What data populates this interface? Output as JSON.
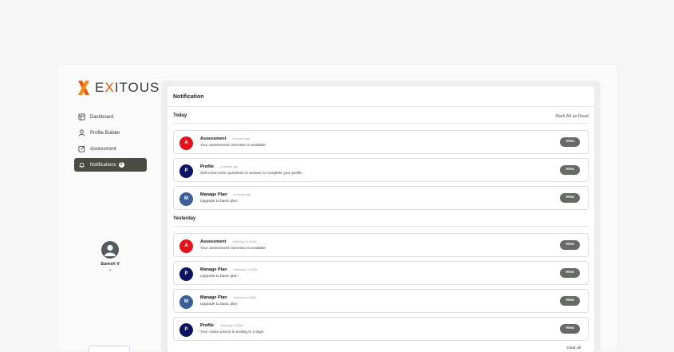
{
  "brand": {
    "name_pre": "E",
    "name_x": "X",
    "name_post": "ITOUS",
    "colors": {
      "orange": "#e8580c",
      "dark": "#3a3a3a"
    }
  },
  "sidebar": {
    "items": [
      {
        "label": "Dashboard",
        "icon": "dashboard-icon"
      },
      {
        "label": "Profile Builder",
        "icon": "user-icon"
      },
      {
        "label": "Assessment",
        "icon": "edit-icon"
      },
      {
        "label": "Notifications",
        "icon": "bell-icon",
        "badge": "2",
        "active": true
      }
    ]
  },
  "user": {
    "name": "Suresh V",
    "chevron": "⌄"
  },
  "panel": {
    "title": "Notification",
    "mark_all_label": "Mark All as Read",
    "clear_all_label": "Clear all",
    "view_label": "View",
    "sections": [
      {
        "label": "Today",
        "items": [
          {
            "letter": "A",
            "color": "#e5131b",
            "title": "Assessment",
            "time": "2 minutes ago",
            "message": "Your assessment overview is available"
          },
          {
            "letter": "P",
            "color": "#0b1464",
            "title": "Profile",
            "time": "4 minutes ago",
            "message": "Still a few more questions to answer to complete your profile"
          },
          {
            "letter": "M",
            "color": "#3a5f9a",
            "title": "Manage Plan",
            "time": "5 minutes ago",
            "message": "Upgrade to basic plan"
          }
        ]
      },
      {
        "label": "Yesterday",
        "items": [
          {
            "letter": "A",
            "color": "#e5131b",
            "title": "Assessment",
            "time": "Yesterday 11:30AM",
            "message": "Your assessment overview is available"
          },
          {
            "letter": "P",
            "color": "#0b1464",
            "title": "Manage Plan",
            "time": "Yesterday 11:30AM",
            "message": "Upgrade to basic plan"
          },
          {
            "letter": "M",
            "color": "#3a5f9a",
            "title": "Manage Plan",
            "time": "Yesterday 9:10AM",
            "message": "Upgrade to basic plan"
          },
          {
            "letter": "P",
            "color": "#0b1464",
            "title": "Profile",
            "time": "Yesterday 9:10AM",
            "message": "Your notice period is ending in 2 days"
          }
        ]
      }
    ]
  }
}
